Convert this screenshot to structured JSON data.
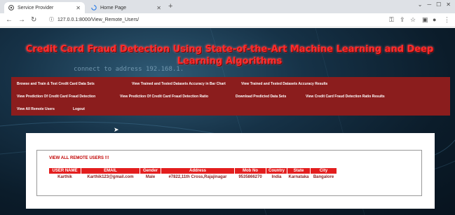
{
  "browser": {
    "tabs": [
      {
        "title": "Service Provider",
        "icon": "browser-icon",
        "active": true
      },
      {
        "title": "Home Page",
        "icon": "loading-icon",
        "active": false
      }
    ],
    "url": "127.0.0.1:8000/View_Remote_Users/"
  },
  "page": {
    "background_text": "connect to address 192.168.1.",
    "title": "Credit Card Fraud Detection Using State-of-the-Art Machine Learning and Deep Learning Algorithms",
    "title_color": "#ff2b2b",
    "menu_color": "#8b1d1d",
    "menu": [
      "Browse and Train & Test Credit Card Data Sets",
      "View Trained and Tested Datasets Accuracy in Bar Chart",
      "View Trained and Tested Datasets Accuracy Results",
      "View Prediction Of Credit Card Fraud Detection",
      "View Prediction Of Credit Card Fraud Detection Ratio",
      "Download Predicted Data Sets",
      "View Credit Card Fraud Detection Ratio Results",
      "View All Remote Users",
      "Logout"
    ],
    "heading": "VIEW ALL REMOTE USERS !!!",
    "table": {
      "headers": [
        "USER NAME",
        "EMAIL",
        "Gender",
        "Address",
        "Mob No",
        "Country",
        "State",
        "City"
      ],
      "rows": [
        [
          "Karthik",
          "Karthik123@gmail.com",
          "Male",
          "#7822,11th Cross,Rajajinagar",
          "9535866270",
          "India",
          "Karnataka",
          "Bangalore"
        ]
      ]
    }
  }
}
